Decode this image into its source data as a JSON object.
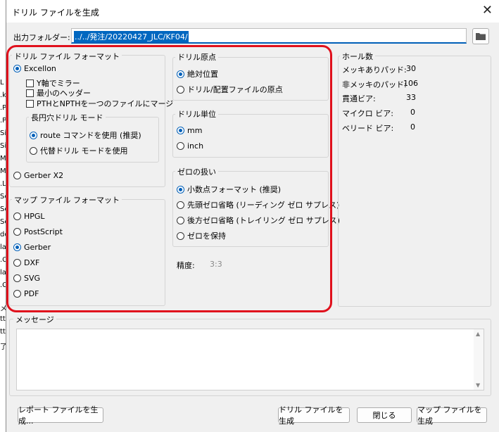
{
  "title": "ドリル ファイルを生成",
  "close_glyph": "✕",
  "output_folder": {
    "label": "出力フォルダー:",
    "value": "../../発注/20220427_JLC/KF04/"
  },
  "drill_format": {
    "title": "ドリル ファイル フォーマット",
    "excellon": "Excellon",
    "mirror_y": "Y軸でミラー",
    "minimal_header": "最小のヘッダー",
    "merge_pth": "PTHとNPTHを一つのファイルにマージ",
    "oval_title": "長円穴ドリル モード",
    "route": "route コマンドを使用 (推奨)",
    "alt_mode": "代替ドリル モードを使用",
    "gerber_x2": "Gerber X2"
  },
  "map_format": {
    "title": "マップ ファイル フォーマット",
    "options": [
      "HPGL",
      "PostScript",
      "Gerber",
      "DXF",
      "SVG",
      "PDF"
    ],
    "selected": "Gerber"
  },
  "drill_origin": {
    "title": "ドリル原点",
    "absolute": "絶対位置",
    "aux": "ドリル/配置ファイルの原点"
  },
  "drill_units": {
    "title": "ドリル単位",
    "mm": "mm",
    "inch": "inch"
  },
  "zeros": {
    "title": "ゼロの扱い",
    "decimal": "小数点フォーマット (推奨)",
    "leading": "先頭ゼロ省略 (リーディング ゼロ サプレス)",
    "trailing": "後方ゼロ省略 (トレイリング ゼロ サプレス)",
    "keep": "ゼロを保持"
  },
  "precision": {
    "label": "精度:",
    "value": "3:3"
  },
  "hole_counts": {
    "title": "ホール数",
    "rows": [
      {
        "label": "メッキありパッド:",
        "value": "30"
      },
      {
        "label": "非メッキのパッド:",
        "value": "106"
      },
      {
        "label": "貫通ビア:",
        "value": "33"
      },
      {
        "label": "マイクロ ビア:",
        "value": "0"
      },
      {
        "label": "ベリード ビア:",
        "value": "0"
      }
    ]
  },
  "messages": {
    "title": "メッセージ"
  },
  "buttons": {
    "report": "レポート ファイルを生成...",
    "gen_drill": "ドリル ファイルを生成",
    "close": "閉じる",
    "gen_map": "マップ ファイルを生成"
  },
  "colors": {
    "accent": "#005fb8",
    "highlight": "#e0101c",
    "selection": "#0067c0"
  }
}
